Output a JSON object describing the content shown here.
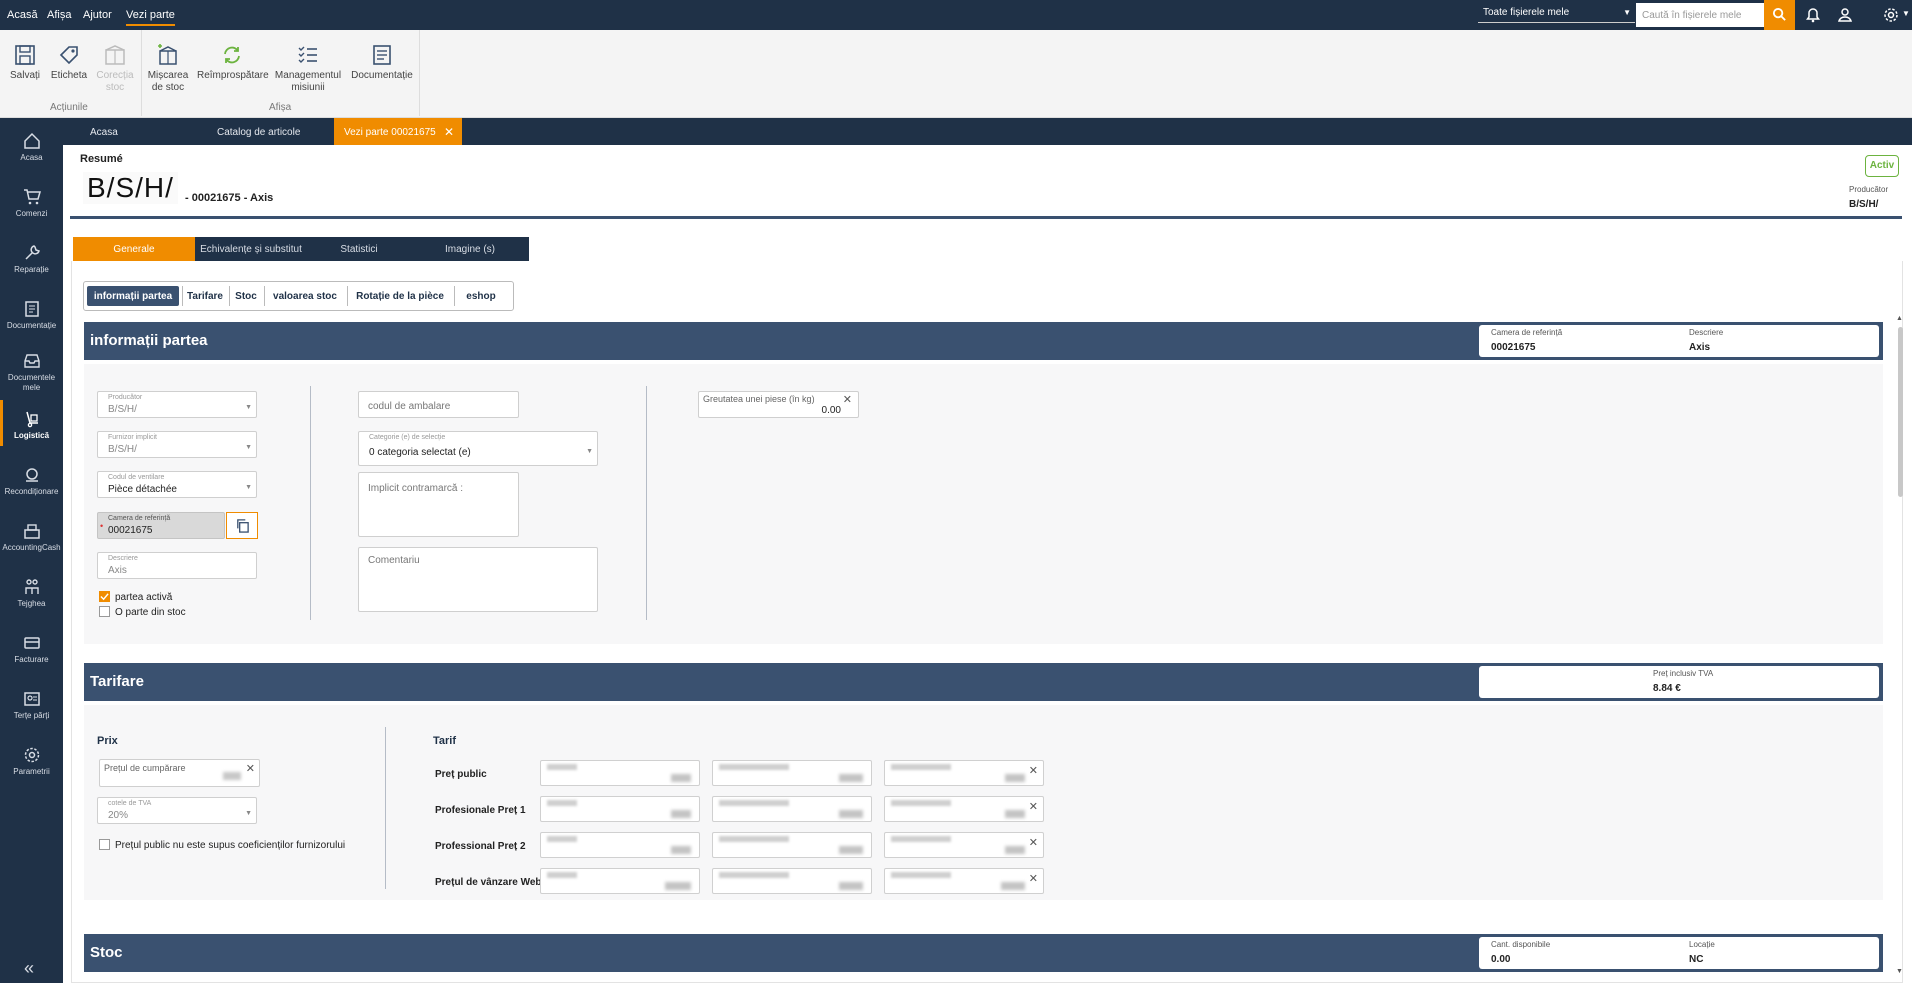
{
  "top_menu": {
    "items": [
      "Acasă",
      "Afișa",
      "Ajutor",
      "Vezi parte"
    ]
  },
  "file_select": {
    "value": "Toate fișierele mele"
  },
  "search": {
    "placeholder": "Caută în fișierele mele"
  },
  "ribbon": {
    "buttons": [
      {
        "line1": "Salvați",
        "line2": ""
      },
      {
        "line1": "Eticheta",
        "line2": ""
      },
      {
        "line1": "Corecția",
        "line2": "stoc"
      },
      {
        "line1": "Mișcarea",
        "line2": "de stoc"
      },
      {
        "line1": "Reîmprospătare",
        "line2": ""
      },
      {
        "line1": "Managementul",
        "line2": "misiunii"
      },
      {
        "line1": "Documentație",
        "line2": ""
      }
    ],
    "groups": [
      "Acțiunile",
      "Afișa"
    ]
  },
  "sidebar": {
    "items": [
      "Acasa",
      "Comenzi",
      "Reparație",
      "Documentație",
      "Documentele mele",
      "Logistică",
      "Recondiționare",
      "AccountingCash",
      "Tejghea",
      "Facturare",
      "Terțe părți",
      "Parametrii"
    ]
  },
  "window_tabs": [
    "Acasa",
    "Catalog de articole",
    "Vezi parte 00021675"
  ],
  "header": {
    "resume": "Resumé",
    "brand": "B/S/H/",
    "subtitle": "- 00021675 - Axis",
    "status": "Activ",
    "producer_label": "Producător",
    "producer_value": "B/S/H/"
  },
  "content_tabs": [
    "Generale",
    "Echivalențe și substitut",
    "Statistici",
    "Imagine (s)"
  ],
  "sub_tabs": [
    "informații partea",
    "Tarifare",
    "Stoc",
    "valoarea stoc",
    "Rotație de la pièce",
    "eshop"
  ],
  "info_section": {
    "title": "informații partea",
    "ref_label": "Camera de referință",
    "ref_value": "00021675",
    "desc_label": "Descriere",
    "desc_value": "Axis",
    "producer": {
      "label": "Producător",
      "value": "B/S/H/"
    },
    "supplier": {
      "label": "Furnizor implicit",
      "value": "B/S/H/"
    },
    "breakdown": {
      "label": "Codul de ventilare",
      "value": "Pièce détachée"
    },
    "reference": {
      "label": "Camera de referință",
      "value": "00021675"
    },
    "description": {
      "label": "Descriere",
      "value": "Axis"
    },
    "active_part": "partea activă",
    "stock_part": "O parte din stoc",
    "packaging": "codul de ambalare",
    "category": {
      "label": "Categorie (e) de selecție",
      "value": "0 categoria selectat (e)"
    },
    "counter_mark": "Implicit contramarcă :",
    "comment": "Comentariu",
    "weight": {
      "label": "Greutatea unei piese (în kg)",
      "value": "0.00"
    }
  },
  "pricing_section": {
    "title": "Tarifare",
    "price_incl_label": "Preț inclusiv TVA",
    "price_incl_value": "8.84 €",
    "prix_title": "Prix",
    "purchase_label": "Prețul de cumpărare",
    "vat_label": "cotele de TVA",
    "vat_value": "20%",
    "public_price_note": "Prețul public nu este supus coeficienților furnizorului",
    "tarif_title": "Tarif",
    "rows": [
      "Preț public",
      "Profesionale Preț 1",
      "Professional Preț 2",
      "Prețul de vânzare Web"
    ]
  },
  "stock_section": {
    "title": "Stoc",
    "qty_label": "Cant. disponibile",
    "qty_value": "0.00",
    "loc_label": "Locație",
    "loc_value": "NC"
  }
}
